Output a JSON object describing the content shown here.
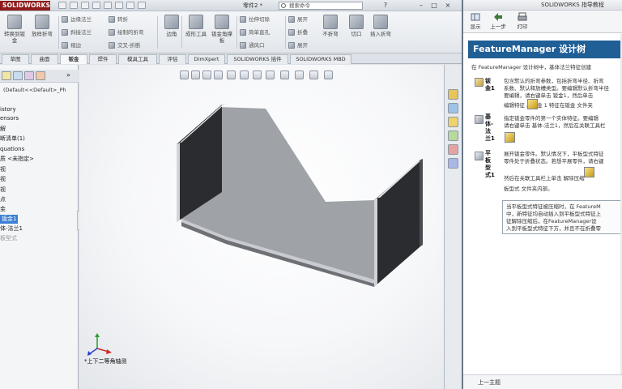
{
  "app": {
    "logo_text": "SOLIDWORKS",
    "doc_title": "零件2 *",
    "search_placeholder": "搜索命令"
  },
  "ribbon": {
    "big_buttons": [
      "转换到钣金",
      "放样折弯",
      "边角",
      "成形工具",
      "钣金角撑板",
      "不折弯",
      "切口",
      "插入折弯"
    ],
    "small_buttons": [
      "边缘法兰",
      "转折",
      "斜接法兰",
      "绘制的折弯",
      "褶边",
      "交叉-折断",
      "拉伸切除",
      "简单直孔",
      "通风口",
      "展开",
      "折叠",
      "展开"
    ]
  },
  "tabs": [
    "草图",
    "曲面",
    "钣金",
    "焊件",
    "模具工具",
    "评估",
    "DimXpert",
    "SOLIDWORKS 插件",
    "SOLIDWORKS MBD"
  ],
  "active_tab": "钣金",
  "tree": {
    "root": "(Default<<Default>_Ph",
    "items": [
      "istory",
      "ensors",
      "解",
      "断清单(1)",
      "quations",
      "质 <未指定>",
      "视",
      "视",
      "视",
      "点",
      "金",
      "钣金1",
      "体-法兰1",
      "板型式"
    ],
    "selected_index": 11
  },
  "viewport": {
    "view_label": "*上下二等角轴测"
  },
  "help": {
    "window_title": "SOLIDWORKS 指导教程",
    "toolbar": [
      "显示",
      "上一步",
      "打印"
    ],
    "heading": "FeatureManager 设计树",
    "intro": "在 FeatureManager 设计树中，基体法兰特征创建",
    "entries": [
      {
        "term": "钣金1",
        "lines": [
          "包含默认的折弯参数，包括折弯半径、折弯",
          "系数、默认释放槽类型。要编辑默认折弯半径",
          "要编辑，请右键单击 钣金1，然后单击",
          "编辑特征  。钣金 1 特征在钣金  文件夹"
        ]
      },
      {
        "term": "基体-法兰1",
        "lines": [
          "",
          "指定钣金零件的第一个实体特征。要编辑",
          "请右键单击 基体-法兰1，然后在关联工具栏"
        ]
      },
      {
        "term": "平板型式1",
        "lines": [
          "展开钣金零件。默认情况下，平板型式特征",
          "零件处于折叠状态。若想平展零件，请右键",
          "",
          "然后在关联工具栏上单击 解除压缩",
          "板型式  文件夹内部。"
        ]
      }
    ],
    "note_lines": [
      "当平板型式特征被压缩时，在 FeatureM",
      "中，新特征均自动插入到平板型式特征上",
      "征解除压缩后，在FeatureManager设",
      "入到平板型式特征下方，并且不在折叠零"
    ],
    "footer": "上一主题"
  }
}
